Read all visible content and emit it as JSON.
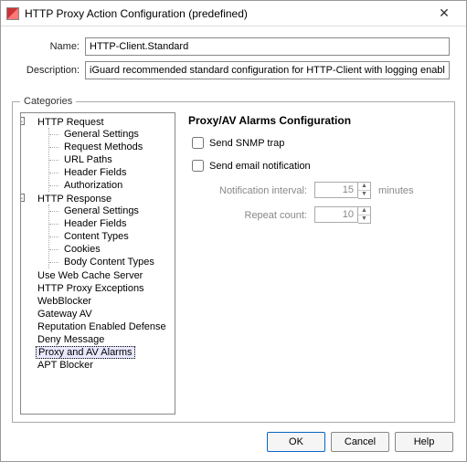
{
  "window": {
    "title": "HTTP Proxy Action Configuration (predefined)"
  },
  "form": {
    "name_label": "Name:",
    "name_value": "HTTP-Client.Standard",
    "desc_label": "Description:",
    "desc_value": "iGuard recommended standard configuration for HTTP-Client with logging enabled"
  },
  "categories_legend": "Categories",
  "tree": {
    "http_request": "HTTP Request",
    "req_general": "General Settings",
    "req_methods": "Request Methods",
    "req_urlpaths": "URL Paths",
    "req_headers": "Header Fields",
    "req_auth": "Authorization",
    "http_response": "HTTP Response",
    "res_general": "General Settings",
    "res_headers": "Header Fields",
    "res_ctypes": "Content Types",
    "res_cookies": "Cookies",
    "res_body": "Body Content Types",
    "webcache": "Use Web Cache Server",
    "proxyexc": "HTTP Proxy Exceptions",
    "webblocker": "WebBlocker",
    "gatewayav": "Gateway AV",
    "repdef": "Reputation Enabled Defense",
    "denymsg": "Deny Message",
    "alarms": "Proxy and AV Alarms",
    "apt": "APT Blocker"
  },
  "pane": {
    "heading": "Proxy/AV Alarms Configuration",
    "snmp_label": "Send SNMP trap",
    "email_label": "Send email notification",
    "interval_label": "Notification interval:",
    "interval_value": "15",
    "interval_unit": "minutes",
    "repeat_label": "Repeat count:",
    "repeat_value": "10"
  },
  "buttons": {
    "ok": "OK",
    "cancel": "Cancel",
    "help": "Help"
  }
}
